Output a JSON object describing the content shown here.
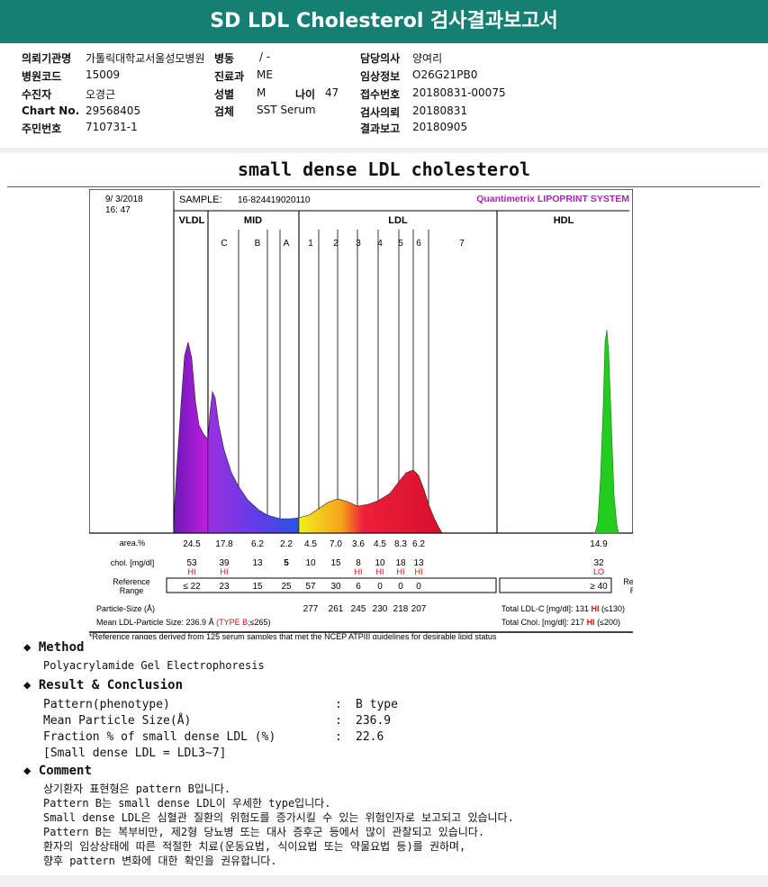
{
  "header": {
    "title": "SD LDL Cholesterol 검사결과보고서"
  },
  "info": {
    "hospital_label": "의뢰기관명",
    "hospital": "가톨릭대학교서울성모병원",
    "ward_label": "병동",
    "ward": "/ -",
    "doctor_label": "담당의사",
    "doctor": "양여리",
    "code_label": "병원코드",
    "code": "15009",
    "dept_label": "진료과",
    "dept": "ME",
    "clinical_label": "임상정보",
    "clinical": "O26G21PB0",
    "patient_label": "수진자",
    "patient": "오경근",
    "sex_label": "성별",
    "sex": "M",
    "age_label": "나이",
    "age": "47",
    "receipt_label": "접수번호",
    "receipt": "20180831-00075",
    "chart_label": "Chart No.",
    "chart": "29568405",
    "specimen_label": "검체",
    "specimen": "SST Serum",
    "request_label": "검사의뢰",
    "request": "20180831",
    "id_label": "주민번호",
    "id": "710731-1",
    "report_label": "결과보고",
    "report": "20180905"
  },
  "subtitle": "small dense LDL cholesterol",
  "chart_data": {
    "type": "area",
    "title": "Quantimetrix LIPOPRINT SYSTEM",
    "date": "9/ 3/2018",
    "time": "16: 47",
    "sample_label": "SAMPLE:",
    "sample": "16-824419020110",
    "sections": [
      "VLDL",
      "MID",
      "LDL",
      "HDL"
    ],
    "bands": [
      "C",
      "B",
      "A",
      "1",
      "2",
      "3",
      "4",
      "5",
      "6",
      "7"
    ],
    "row_labels": {
      "area": "area.%",
      "chol": "chol. [mg/dl]",
      "ref": "Reference Range",
      "particle": "Particle-Size (Å)"
    },
    "area": [
      "24.5",
      "17.8",
      "6.2",
      "2.2",
      "4.5",
      "7.0",
      "3.6",
      "4.5",
      "8.3",
      "6.2"
    ],
    "hdl_area": "14.9",
    "chol": [
      "53",
      "39",
      "13",
      "5",
      "10",
      "15",
      "8",
      "10",
      "18",
      "13"
    ],
    "chol_flag": [
      "HI",
      "HI",
      "",
      "",
      "",
      "",
      "HI",
      "HI",
      "HI",
      "HI"
    ],
    "hdl_chol": "32",
    "hdl_flag": "LO",
    "ref_range": [
      "≤ 22",
      "23",
      "15",
      "25",
      "57",
      "30",
      "6",
      "0",
      "0",
      "0"
    ],
    "hdl_ref": "≥ 40",
    "ref_right": "Reference Range",
    "particle_size": [
      "277",
      "261",
      "245",
      "230",
      "218",
      "207"
    ],
    "total_ldl_label": "Total LDL-C [mg/dl]:",
    "total_ldl": "131",
    "total_ldl_flag": "HI",
    "total_ldl_ref": "(≤130)",
    "total_chol_label": "Total Chol. [mg/dl]:",
    "total_chol": "217",
    "total_chol_flag": "HI",
    "total_chol_ref": "(≤200)",
    "mean_label": "Mean LDL-Particle Size:",
    "mean": "236.9 Å",
    "mean_type": "(TYPE B;",
    "mean_ref": "≤265)",
    "footnote": "*Reference ranges derived from 125 serum samples that met the NCEP ATPIII guidelines for desirable lipid status"
  },
  "method": {
    "title": "Method",
    "text": "Polyacrylamide Gel Electrophoresis"
  },
  "result": {
    "title": "Result & Conclusion",
    "rows": [
      {
        "label": "Pattern(phenotype)",
        "sep": ":",
        "value": "B type"
      },
      {
        "label": "Mean Particle Size(Å)",
        "sep": ":",
        "value": "236.9"
      },
      {
        "label": "Fraction % of small dense LDL (%)",
        "sep": ":",
        "value": "22.6"
      }
    ],
    "note": "[Small dense LDL = LDL3~7]"
  },
  "comment": {
    "title": "Comment",
    "lines": [
      "상기환자 표현형은 pattern B입니다.",
      "Pattern B는 small dense LDL이 우세한 type입니다.",
      "Small dense LDL은 심혈관 질환의 위험도를 증가시킬 수 있는 위험인자로 보고되고 있습니다.",
      "Pattern B는 복부비만, 제2형 당뇨병 또는 대사 증후군 등에서 많이 관찰되고 있습니다.",
      "환자의 임상상태에 따른 적절한 치료(운동요법, 식이요법 또는 약물요법 등)를 권하며,",
      "향후 pattern 변화에 대한 확인을 권유합니다."
    ]
  }
}
